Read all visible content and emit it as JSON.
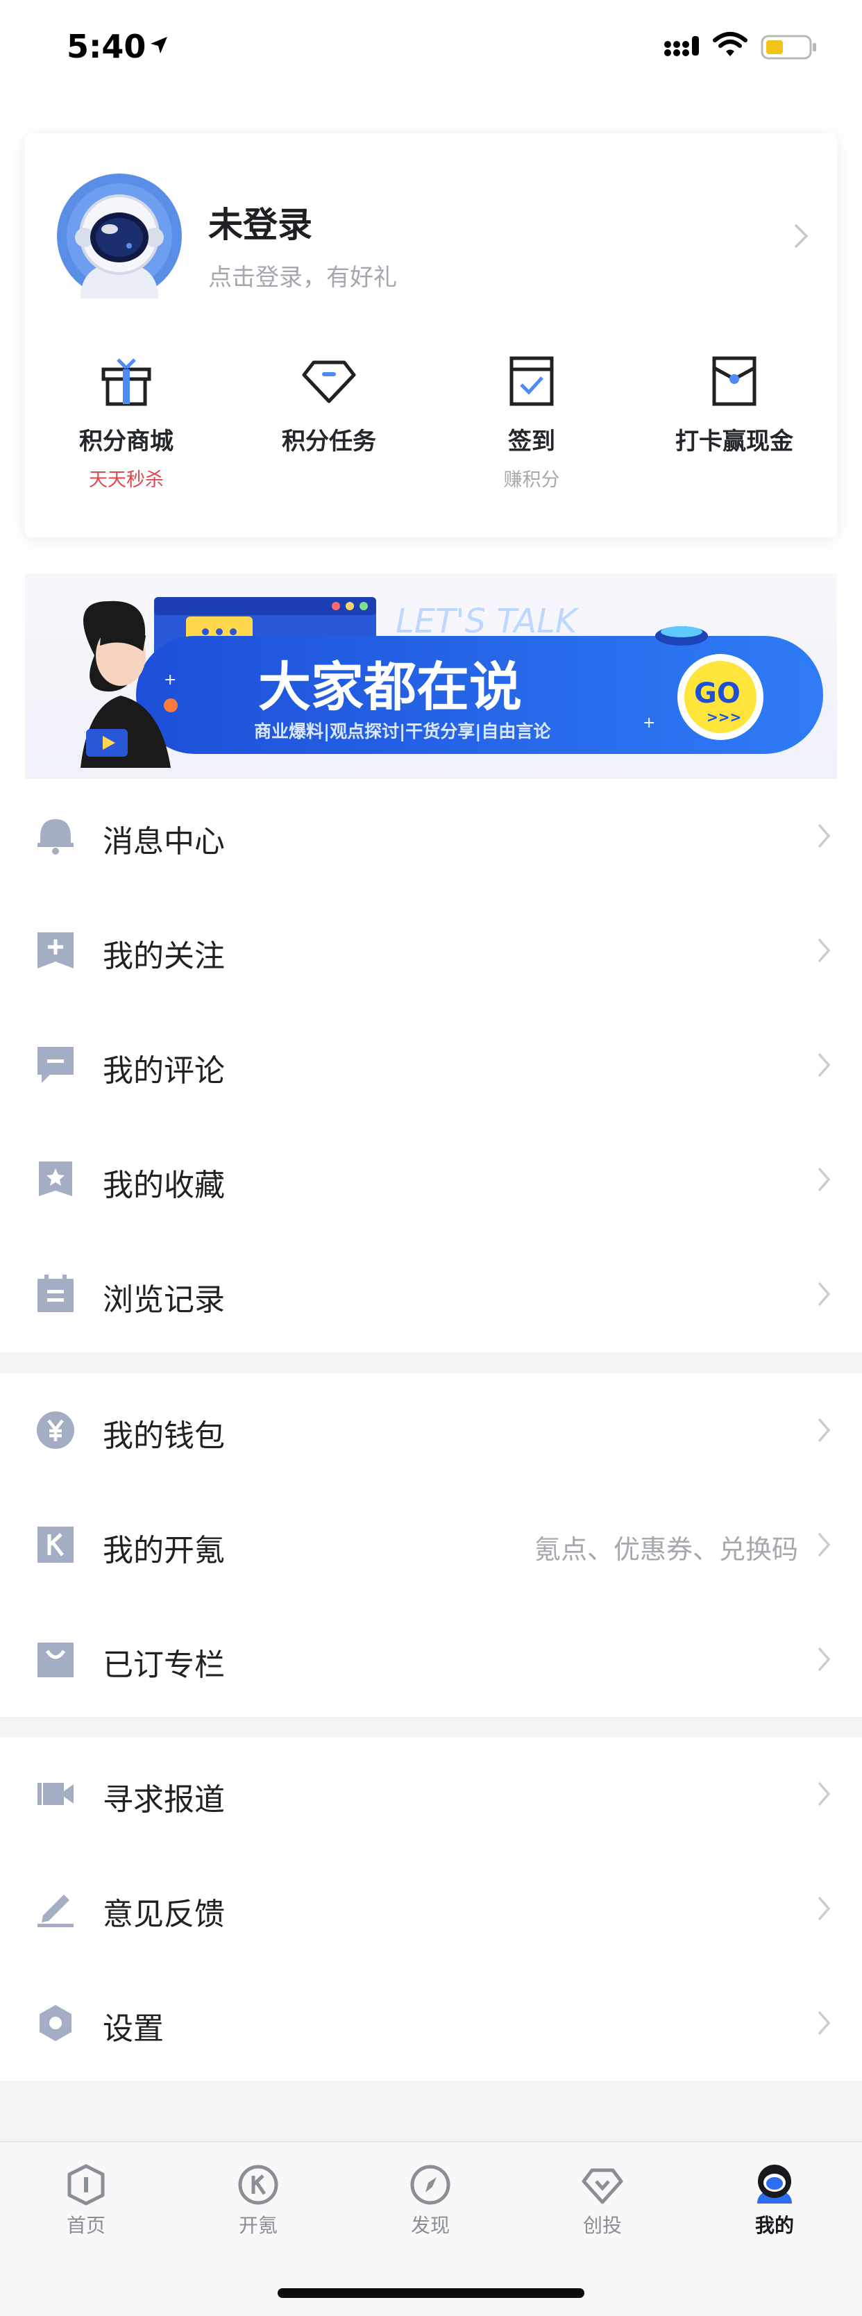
{
  "status_bar": {
    "time": "5:40"
  },
  "profile": {
    "name": "未登录",
    "subtitle": "点击登录，有好礼"
  },
  "quick_actions": [
    {
      "label": "积分商城",
      "sub": "天天秒杀",
      "sub_color": "#e0474f",
      "icon": "gift-box-icon"
    },
    {
      "label": "积分任务",
      "sub": "",
      "sub_color": "#a5a9ae",
      "icon": "diamond-icon"
    },
    {
      "label": "签到",
      "sub": "赚积分",
      "sub_color": "#a5a9ae",
      "icon": "checkin-icon"
    },
    {
      "label": "打卡赢现金",
      "sub": "",
      "sub_color": "#a5a9ae",
      "icon": "envelope-icon"
    }
  ],
  "banner": {
    "title": "大家都在说",
    "subtitle": "商业爆料|观点探讨|干货分享|自由言论",
    "overlay_text": "LET'S TALK",
    "go_label": "GO",
    "go_arrows": ">>>"
  },
  "menu_groups": [
    [
      {
        "label": "消息中心",
        "icon": "bell-icon"
      },
      {
        "label": "我的关注",
        "icon": "follow-bookmark-icon"
      },
      {
        "label": "我的评论",
        "icon": "comment-icon"
      },
      {
        "label": "我的收藏",
        "icon": "star-bookmark-icon"
      },
      {
        "label": "浏览记录",
        "icon": "history-clipboard-icon"
      }
    ],
    [
      {
        "label": "我的钱包",
        "icon": "yen-wallet-icon"
      },
      {
        "label": "我的开氪",
        "icon": "k-badge-icon",
        "extra": "氪点、优惠券、兑换码"
      },
      {
        "label": "已订专栏",
        "icon": "shopping-bag-icon"
      }
    ],
    [
      {
        "label": "寻求报道",
        "icon": "video-camera-icon"
      },
      {
        "label": "意见反馈",
        "icon": "pencil-icon"
      },
      {
        "label": "设置",
        "icon": "hexagon-settings-icon"
      }
    ]
  ],
  "tabs": [
    {
      "label": "首页",
      "icon": "home-shield-icon",
      "active": false
    },
    {
      "label": "开氪",
      "icon": "k-circle-icon",
      "active": false
    },
    {
      "label": "发现",
      "icon": "compass-icon",
      "active": false
    },
    {
      "label": "创投",
      "icon": "venture-diamond-icon",
      "active": false
    },
    {
      "label": "我的",
      "icon": "astronaut-profile-icon",
      "active": true
    }
  ],
  "colors": {
    "icon_gray": "#a3aec4",
    "accent_blue": "#2f6df0",
    "sale_red": "#e0474f"
  }
}
